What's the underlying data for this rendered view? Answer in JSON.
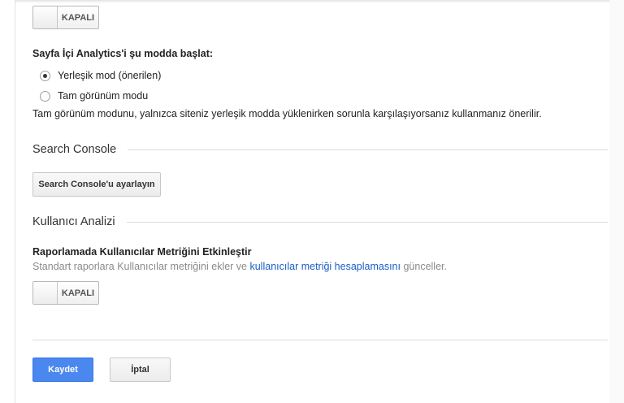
{
  "top_toggle": {
    "label": "KAPALI"
  },
  "inpage": {
    "title": "Sayfa İçi Analytics'i şu modda başlat:",
    "options": [
      {
        "label": "Yerleşik mod (önerilen)",
        "checked": true
      },
      {
        "label": "Tam görünüm modu",
        "checked": false
      }
    ],
    "note": "Tam görünüm modunu, yalnızca siteniz yerleşik modda yüklenirken sorunla karşılaşıyorsanız kullanmanız önerilir."
  },
  "search_console": {
    "heading": "Search Console",
    "button_label": "Search Console'u ayarlayın"
  },
  "user_analysis": {
    "heading": "Kullanıcı Analizi",
    "title": "Raporlamada Kullanıcılar Metriğini Etkinleştir",
    "desc_prefix": "Standart raporlara Kullanıcılar metriğini ekler ve ",
    "desc_link": "kullanıcılar metriği hesaplamasını",
    "desc_suffix": " günceller.",
    "toggle_label": "KAPALI"
  },
  "actions": {
    "save": "Kaydet",
    "cancel": "İptal"
  },
  "colors": {
    "primary_button": "#4a87ee",
    "link": "#1a5ec3"
  }
}
